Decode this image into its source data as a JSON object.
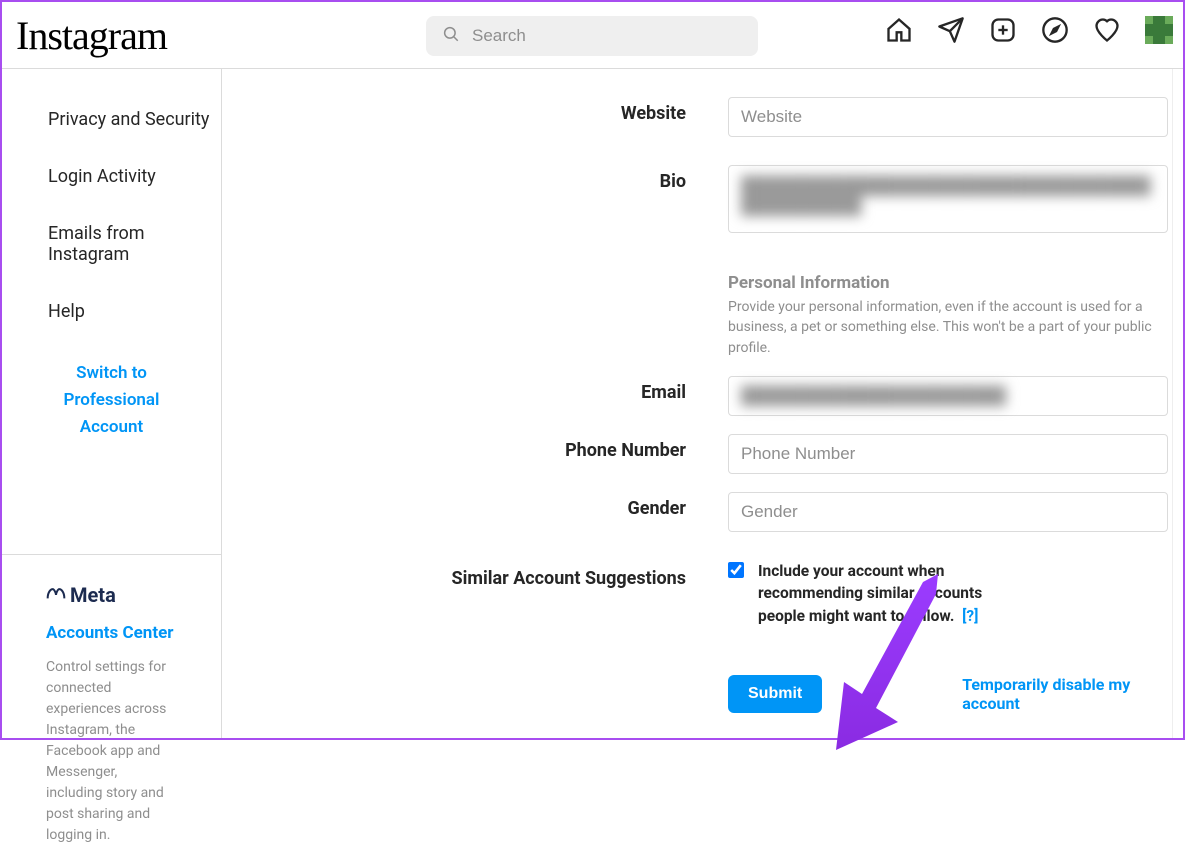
{
  "brand": "Instagram",
  "search": {
    "placeholder": "Search"
  },
  "sidebar": {
    "items": [
      {
        "label": "Privacy and Security"
      },
      {
        "label": "Login Activity"
      },
      {
        "label": "Emails from Instagram"
      },
      {
        "label": "Help"
      }
    ],
    "switch_link": "Switch to Professional Account",
    "meta_brand": "Meta",
    "accounts_center": "Accounts Center",
    "accounts_center_desc": "Control settings for connected experiences across Instagram, the Facebook app and Messenger, including story and post sharing and logging in."
  },
  "form": {
    "website": {
      "label": "Website",
      "placeholder": "Website",
      "value": ""
    },
    "bio": {
      "label": "Bio",
      "value": "████████████████████████████████████████████"
    },
    "personal_info": {
      "heading": "Personal Information",
      "desc": "Provide your personal information, even if the account is used for a business, a pet or something else. This won't be a part of your public profile."
    },
    "email": {
      "label": "Email",
      "value": "██████████████████████"
    },
    "phone": {
      "label": "Phone Number",
      "placeholder": "Phone Number",
      "value": ""
    },
    "gender": {
      "label": "Gender",
      "placeholder": "Gender",
      "value": ""
    },
    "similar": {
      "label": "Similar Account Suggestions",
      "checkbox_label": "Include your account when recommending similar accounts people might want to follow.",
      "help": "[?]"
    },
    "submit": "Submit",
    "disable_link": "Temporarily disable my account"
  }
}
